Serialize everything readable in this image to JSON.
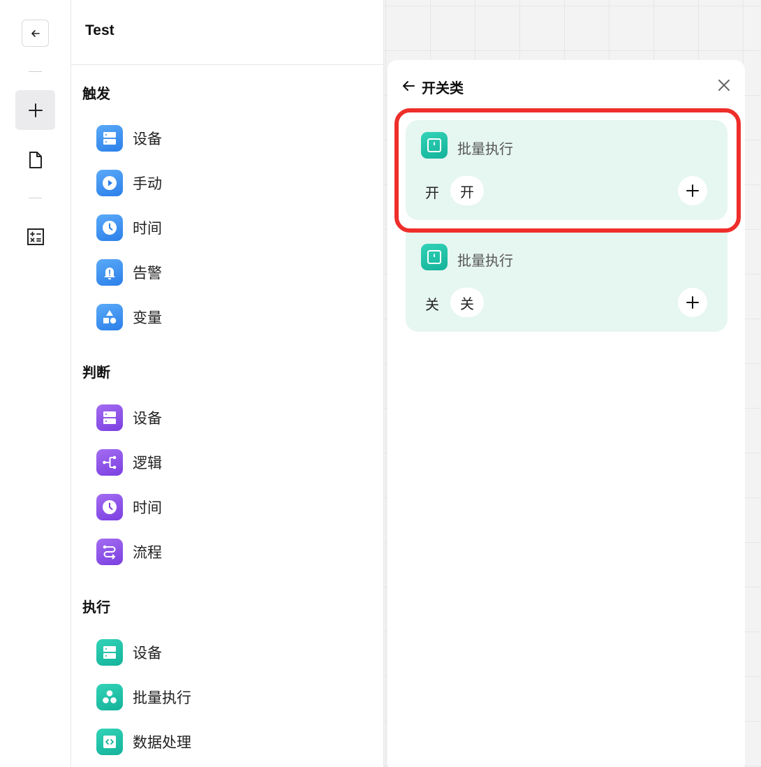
{
  "colors": {
    "trigger_accent": "#2b7fe9",
    "judge_accent": "#7b3fe0",
    "exec_accent": "#14b29a",
    "card_bg": "#e6f6f1",
    "highlight": "#ee2e2a"
  },
  "rail": {
    "back_icon": "arrow-left-icon",
    "add_icon": "plus-icon",
    "file_icon": "file-icon",
    "calc_icon": "calculator-icon"
  },
  "panel": {
    "title": "Test",
    "sections": [
      {
        "title": "触发",
        "items": [
          {
            "label": "设备",
            "icon": "server-icon"
          },
          {
            "label": "手动",
            "icon": "play-icon"
          },
          {
            "label": "时间",
            "icon": "clock-icon"
          },
          {
            "label": "告警",
            "icon": "alarm-bell-icon"
          },
          {
            "label": "变量",
            "icon": "shapes-icon"
          }
        ]
      },
      {
        "title": "判断",
        "items": [
          {
            "label": "设备",
            "icon": "server-icon"
          },
          {
            "label": "逻辑",
            "icon": "branch-icon"
          },
          {
            "label": "时间",
            "icon": "clock-icon"
          },
          {
            "label": "流程",
            "icon": "flow-icon"
          }
        ]
      },
      {
        "title": "执行",
        "items": [
          {
            "label": "设备",
            "icon": "server-icon"
          },
          {
            "label": "批量执行",
            "icon": "cluster-icon"
          },
          {
            "label": "数据处理",
            "icon": "code-icon"
          }
        ]
      }
    ]
  },
  "popup": {
    "title": "开关类",
    "back_icon": "arrow-left-icon",
    "close_icon": "close-icon",
    "cards": [
      {
        "title": "批量执行",
        "key": "开",
        "value": "开",
        "icon": "switch-icon",
        "add_icon": "plus-icon"
      },
      {
        "title": "批量执行",
        "key": "关",
        "value": "关",
        "icon": "switch-icon",
        "add_icon": "plus-icon"
      }
    ]
  }
}
